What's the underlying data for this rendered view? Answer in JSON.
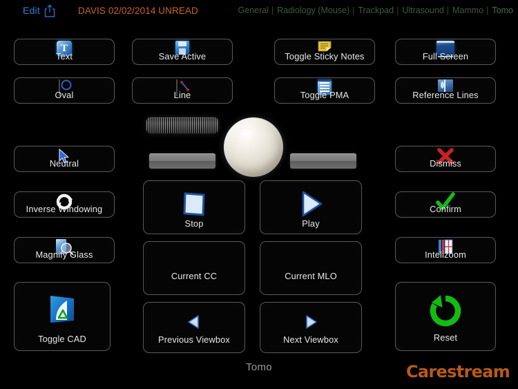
{
  "topbar": {
    "edit_label": "Edit",
    "share_icon": "share-upload-icon",
    "patient": "DAVIS 02/02/2014 UNREAD",
    "separator": "|",
    "tabs": [
      {
        "label": "General"
      },
      {
        "label": "Radiology (Mouse)"
      },
      {
        "label": "Trackpad"
      },
      {
        "label": "Ultrasound"
      },
      {
        "label": "Mammo"
      },
      {
        "label": "Tomo"
      }
    ]
  },
  "left_column": [
    {
      "label": "Text",
      "icon": "text-tool-icon"
    },
    {
      "label": "Oval",
      "icon": "oval-tool-icon"
    },
    {
      "label": "Neutral",
      "icon": "cursor-arrow-icon"
    },
    {
      "label": "Inverse Windowing",
      "icon": "inverse-windowing-icon"
    },
    {
      "label": "Magnify Glass",
      "icon": "magnify-glass-icon"
    },
    {
      "label": "Toggle CAD",
      "icon": "cad-icon"
    }
  ],
  "second_column": [
    {
      "label": "Save Active",
      "icon": "floppy-disk-icon"
    },
    {
      "label": "Line",
      "icon": "line-tool-icon"
    }
  ],
  "third_column": [
    {
      "label": "Toggle Sticky Notes",
      "icon": "sticky-note-icon"
    },
    {
      "label": "Toggle PMA",
      "icon": "pma-list-icon"
    }
  ],
  "right_column": [
    {
      "label": "Full Screen",
      "icon": "monitor-icon"
    },
    {
      "label": "Reference Lines",
      "icon": "reference-lines-icon"
    },
    {
      "label": "Dismiss",
      "icon": "red-x-icon"
    },
    {
      "label": "Confirm",
      "icon": "green-check-icon"
    },
    {
      "label": "Intelizoom",
      "icon": "intelizoom-window-icon"
    },
    {
      "label": "Reset",
      "icon": "green-reset-arrow-icon"
    }
  ],
  "trackpad": {
    "scroll_wheel": "scroll-wheel",
    "trackball": "trackball",
    "left_button": "trackball-left-button",
    "right_button": "trackball-right-button"
  },
  "center_grid": [
    {
      "label": "Stop",
      "icon": "stop-square-icon"
    },
    {
      "label": "Play",
      "icon": "play-triangle-icon"
    },
    {
      "label": "Current CC",
      "icon": "none"
    },
    {
      "label": "Current MLO",
      "icon": "none"
    },
    {
      "label": "Previous Viewbox",
      "icon": "triangle-left-icon"
    },
    {
      "label": "Next Viewbox",
      "icon": "triangle-right-icon"
    }
  ],
  "footer": {
    "mode": "Tomo",
    "brand": "Carestream"
  },
  "colors": {
    "background": "#000000",
    "edit_blue": "#2f7fe0",
    "patient_orange": "#c8661b",
    "tab_green": "#3f5a3f",
    "brand_orange": "#b85a18",
    "button_border": "#5a5a5a",
    "label_white": "#e9e9e9",
    "dismiss_red": "#cc2222",
    "confirm_green": "#18b818",
    "reset_green": "#13bb13"
  }
}
